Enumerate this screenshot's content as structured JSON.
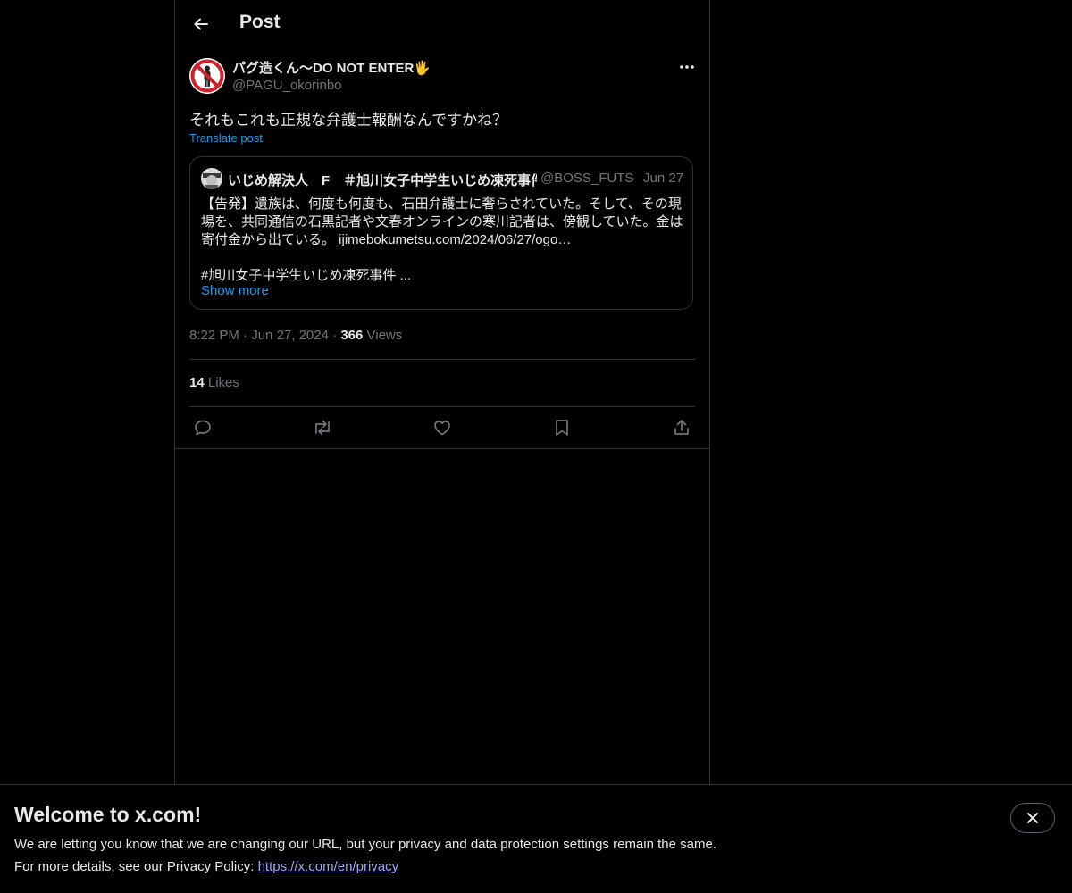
{
  "header": {
    "title": "Post"
  },
  "post": {
    "author_name": "パグ造くん〜DO NOT ENTER🖐",
    "author_handle": "@PAGU_okorinbo",
    "text": "それもこれも正規な弁護士報酬なんですかね？",
    "translate_label": "Translate post",
    "time": "8:22 PM",
    "date": "Jun 27, 2024",
    "views_count": "366",
    "views_label": "Views",
    "likes_count": "14",
    "likes_label": "Likes"
  },
  "quote": {
    "author_name": "いじめ解決人　F　＃旭川女子中学生いじめ凍死事件",
    "author_handle": "@BOSS_FUTS",
    "date": "Jun 27",
    "line1": "【告発】遺族は、何度も何度も、石田弁護士に奢らされていた。そして、その現",
    "line2": "場を、共同通信の石黒記者や文春オンラインの寒川記者は、傍観していた。金は",
    "line3": "寄付金から出ている。 ijimebokumetsu.com/2024/06/27/ogo…",
    "line4": "#旭川女子中学生いじめ凍死事件 ...",
    "show_more": "Show more"
  },
  "banner": {
    "title": "Welcome to x.com!",
    "line1": "We are letting you know that we are changing our URL, but your privacy and data protection settings remain the same.",
    "line2_prefix": "For more details, see our Privacy Policy: ",
    "link": "https://x.com/en/privacy"
  },
  "icons": {
    "back": "arrow-left-icon",
    "more": "ellipsis-icon",
    "reply": "reply-icon",
    "repost": "repost-icon",
    "like": "heart-icon",
    "bookmark": "bookmark-icon",
    "share": "share-icon",
    "close": "close-icon"
  },
  "colors": {
    "background": "#000000",
    "text": "#e7e9ea",
    "muted": "#71767b",
    "link": "#1d9bf0",
    "border": "#2f3336"
  }
}
